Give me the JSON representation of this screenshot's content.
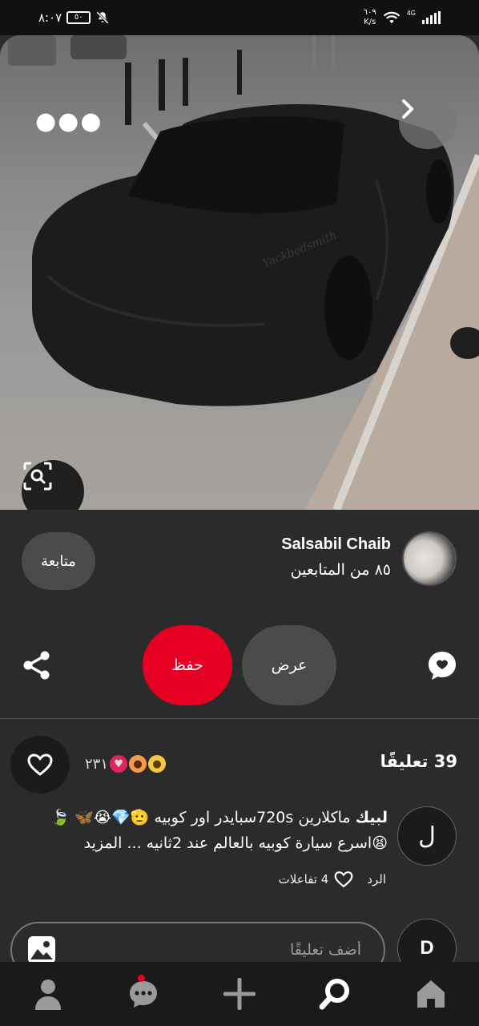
{
  "status_bar": {
    "time": "٨:٠٧",
    "battery": "٥٠",
    "speed": "٦٠٩",
    "speed_unit": "K/s",
    "network": "4G"
  },
  "pin": {
    "more_icon": "more-horizontal-icon",
    "next_icon": "chevron-right-icon",
    "visual_search_icon": "visual-search-icon",
    "image_watermark": "Yackbedsmith"
  },
  "profile": {
    "name": "Salsabil Chaib",
    "followers": "٨٥ من المتابعين",
    "follow_label": "متابعة"
  },
  "actions": {
    "save_label": "حفظ",
    "view_label": "عرض",
    "save_color": "#e60023"
  },
  "comments": {
    "count_label": "39 تعليقًا",
    "reaction_count": "٢٣١",
    "items": [
      {
        "avatar_letter": "ل",
        "author": "لبيك",
        "text": " ماكلارين 720sسبايدر اور كوبيه 🫡💎😭🦋 🍃😫اسرع سيارة كوبيه بالعالم عند 2ثانيه ... المزيد",
        "reply_label": "الرد",
        "reactions_label": "4 تفاعلات"
      }
    ],
    "input_placeholder": "أضف تعليقًا",
    "me_avatar_letter": "D"
  },
  "nav": {
    "items": [
      "home-icon",
      "search-icon",
      "add-icon",
      "messages-icon",
      "profile-icon"
    ]
  }
}
